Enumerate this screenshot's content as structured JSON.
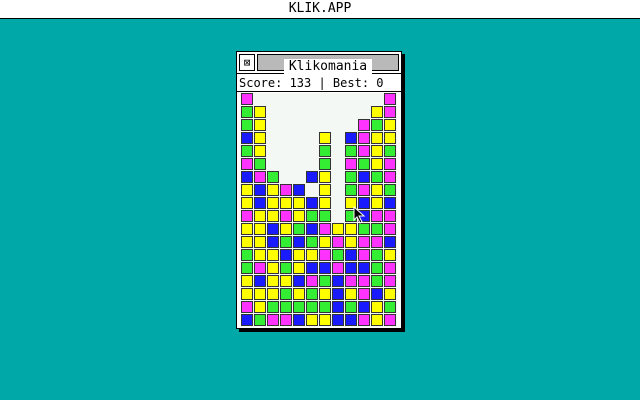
{
  "menubar": {
    "title": "KLIK.APP"
  },
  "window": {
    "title": "Klikomania",
    "close_glyph": "⊠",
    "score_text": "Score: 133 | Best: 0"
  },
  "colors": {
    "desktop": "#00a8a8",
    "M": "#ff33ff",
    "G": "#33ee33",
    "Y": "#ffff00",
    "B": "#1a1aff"
  },
  "board": {
    "columns": 12,
    "rows": 18,
    "grid": [
      "M..........M",
      "GY........YM",
      "GY.......MGY",
      "BY....Y.BMYY",
      "GY....G.GMYG",
      "MG....G.MGYM",
      "BMG..BY.GBGM",
      "YBYMB.Y.GMYG",
      "YBYYYBY.YBYB",
      "MYYMYGG.GBMM",
      "YYBYGBMYYGGM",
      "YYBGBGYMYMMB",
      "GYYBYYMGBMGY",
      "GMYGYBBMBBGM",
      "YBYYBMGBMMGM",
      "YYYGYGYBYMBY",
      "MYGGGGGBGBYG",
      "BGMMBYYBBMYM"
    ]
  }
}
